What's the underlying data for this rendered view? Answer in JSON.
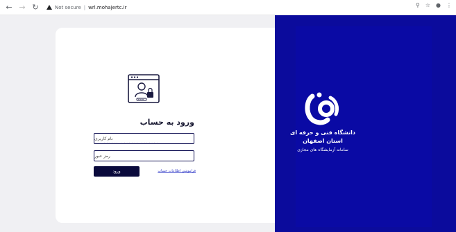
{
  "browser": {
    "security_label": "Not secure",
    "url": "wrl.mohajertc.ir"
  },
  "login": {
    "title": "ورود به حساب",
    "username_placeholder": "نام کاربری",
    "username_ghost": "...... ....... .......",
    "password_placeholder": "رمز عبور",
    "submit_label": "ورود",
    "forgot_link": "فراموشی اطلاعات حساب"
  },
  "brand": {
    "university_name_line1": "دانشگاه فنی و حرفه ای",
    "university_name_line2": "استان اصفهان",
    "subtitle": "سامانه آزمایشگاه های مجازی"
  },
  "colors": {
    "brand_blue": "#0b0b9c",
    "button_navy": "#0a0a3c",
    "link_blue": "#3f48cc"
  }
}
